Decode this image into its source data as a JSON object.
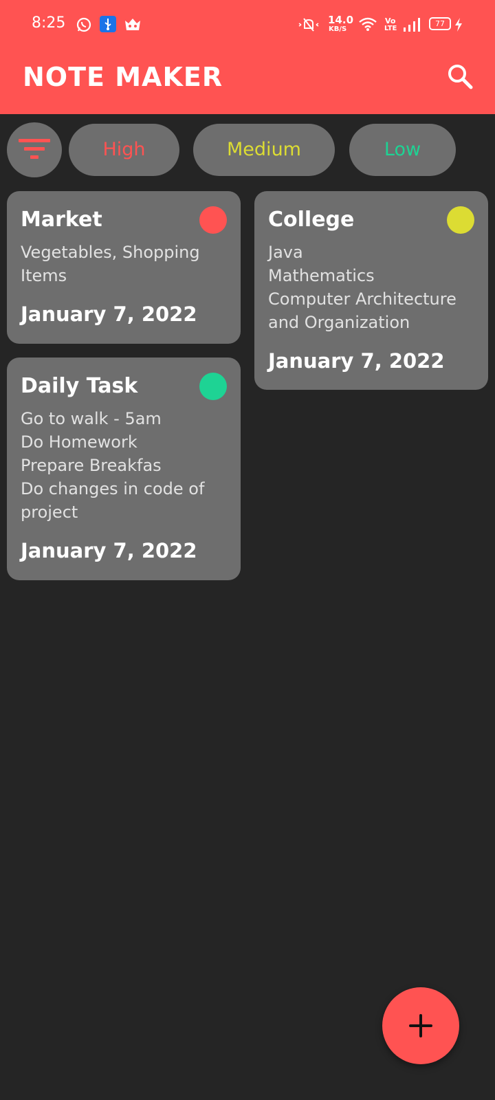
{
  "status_bar": {
    "time": "8:25",
    "net_speed_value": "14.0",
    "net_speed_unit": "KB/S",
    "volte_top": "Vo",
    "volte_bottom": "LTE",
    "battery": "77"
  },
  "app_bar": {
    "title": "NOTE MAKER",
    "search_icon": "search-icon"
  },
  "filters": {
    "filter_icon": "filter-icon",
    "chips": [
      {
        "label": "High",
        "color": "#ff5352"
      },
      {
        "label": "Medium",
        "color": "#dcdc33"
      },
      {
        "label": "Low",
        "color": "#1ed394"
      }
    ]
  },
  "notes": [
    {
      "title": "Market",
      "body": "Vegetables, Shopping\nItems",
      "date": "January 7, 2022",
      "priority": "High",
      "priority_color": "#ff5352"
    },
    {
      "title": "College",
      "body": "Java\nMathematics\nComputer Architecture\nand Organization",
      "date": "January 7, 2022",
      "priority": "Medium",
      "priority_color": "#dcdc33"
    },
    {
      "title": "Daily Task",
      "body": "Go to walk - 5am\nDo Homework\nPrepare Breakfas\nDo changes in code of\nproject",
      "date": "January 7, 2022",
      "priority": "Low",
      "priority_color": "#1ed394"
    }
  ],
  "fab": {
    "icon": "plus-icon"
  },
  "colors": {
    "accent": "#ff5352",
    "background": "#252525",
    "card": "#6e6e6e"
  }
}
